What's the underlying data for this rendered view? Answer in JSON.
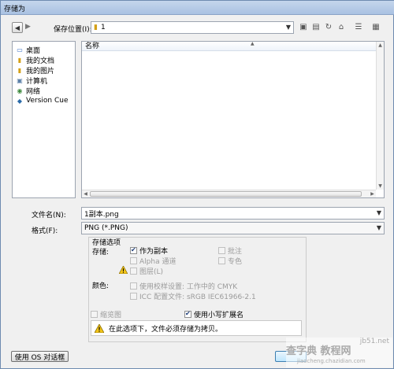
{
  "window": {
    "title": "存储为"
  },
  "location": {
    "label": "保存位置(I):",
    "value": "1"
  },
  "sidebar": {
    "items": [
      {
        "label": "桌面",
        "icon": "desktop-icon"
      },
      {
        "label": "我的文档",
        "icon": "folder-icon"
      },
      {
        "label": "我的图片",
        "icon": "folder-icon"
      },
      {
        "label": "计算机",
        "icon": "computer-icon"
      },
      {
        "label": "网络",
        "icon": "network-icon"
      },
      {
        "label": "Version Cue",
        "icon": "version-cue-icon"
      }
    ]
  },
  "filelist": {
    "column": "名称"
  },
  "filename": {
    "label": "文件名(N):",
    "value": "1副本.png"
  },
  "format": {
    "label": "格式(F):",
    "value": "PNG (*.PNG)"
  },
  "save_options": {
    "title": "存储选项",
    "store_label": "存储:",
    "as_copy": "作为副本",
    "notes": "批注",
    "alpha": "Alpha 通道",
    "spot": "专色",
    "layers": "图层(L)",
    "color_label": "颜色:",
    "proof": "使用校样设置: 工作中的 CMYK",
    "icc": "ICC 配置文件: sRGB IEC61966-2.1",
    "thumbnail": "缩览图",
    "lowercase": "使用小写扩展名",
    "message": "在此选项下，文件必须存储为拷贝。"
  },
  "footer": {
    "os_dialog": "使用 OS 对话框"
  },
  "watermark": {
    "text": "查字典 教程网",
    "sub": "jiaocheng.chazidian.com",
    "site": "jb51.net"
  }
}
